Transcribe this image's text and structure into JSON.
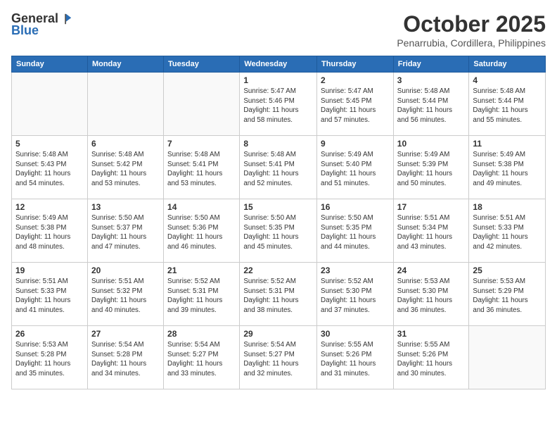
{
  "header": {
    "logo_general": "General",
    "logo_blue": "Blue",
    "month": "October 2025",
    "location": "Penarrubia, Cordillera, Philippines"
  },
  "weekdays": [
    "Sunday",
    "Monday",
    "Tuesday",
    "Wednesday",
    "Thursday",
    "Friday",
    "Saturday"
  ],
  "weeks": [
    [
      {
        "day": "",
        "info": ""
      },
      {
        "day": "",
        "info": ""
      },
      {
        "day": "",
        "info": ""
      },
      {
        "day": "1",
        "info": "Sunrise: 5:47 AM\nSunset: 5:46 PM\nDaylight: 11 hours\nand 58 minutes."
      },
      {
        "day": "2",
        "info": "Sunrise: 5:47 AM\nSunset: 5:45 PM\nDaylight: 11 hours\nand 57 minutes."
      },
      {
        "day": "3",
        "info": "Sunrise: 5:48 AM\nSunset: 5:44 PM\nDaylight: 11 hours\nand 56 minutes."
      },
      {
        "day": "4",
        "info": "Sunrise: 5:48 AM\nSunset: 5:44 PM\nDaylight: 11 hours\nand 55 minutes."
      }
    ],
    [
      {
        "day": "5",
        "info": "Sunrise: 5:48 AM\nSunset: 5:43 PM\nDaylight: 11 hours\nand 54 minutes."
      },
      {
        "day": "6",
        "info": "Sunrise: 5:48 AM\nSunset: 5:42 PM\nDaylight: 11 hours\nand 53 minutes."
      },
      {
        "day": "7",
        "info": "Sunrise: 5:48 AM\nSunset: 5:41 PM\nDaylight: 11 hours\nand 53 minutes."
      },
      {
        "day": "8",
        "info": "Sunrise: 5:48 AM\nSunset: 5:41 PM\nDaylight: 11 hours\nand 52 minutes."
      },
      {
        "day": "9",
        "info": "Sunrise: 5:49 AM\nSunset: 5:40 PM\nDaylight: 11 hours\nand 51 minutes."
      },
      {
        "day": "10",
        "info": "Sunrise: 5:49 AM\nSunset: 5:39 PM\nDaylight: 11 hours\nand 50 minutes."
      },
      {
        "day": "11",
        "info": "Sunrise: 5:49 AM\nSunset: 5:38 PM\nDaylight: 11 hours\nand 49 minutes."
      }
    ],
    [
      {
        "day": "12",
        "info": "Sunrise: 5:49 AM\nSunset: 5:38 PM\nDaylight: 11 hours\nand 48 minutes."
      },
      {
        "day": "13",
        "info": "Sunrise: 5:50 AM\nSunset: 5:37 PM\nDaylight: 11 hours\nand 47 minutes."
      },
      {
        "day": "14",
        "info": "Sunrise: 5:50 AM\nSunset: 5:36 PM\nDaylight: 11 hours\nand 46 minutes."
      },
      {
        "day": "15",
        "info": "Sunrise: 5:50 AM\nSunset: 5:35 PM\nDaylight: 11 hours\nand 45 minutes."
      },
      {
        "day": "16",
        "info": "Sunrise: 5:50 AM\nSunset: 5:35 PM\nDaylight: 11 hours\nand 44 minutes."
      },
      {
        "day": "17",
        "info": "Sunrise: 5:51 AM\nSunset: 5:34 PM\nDaylight: 11 hours\nand 43 minutes."
      },
      {
        "day": "18",
        "info": "Sunrise: 5:51 AM\nSunset: 5:33 PM\nDaylight: 11 hours\nand 42 minutes."
      }
    ],
    [
      {
        "day": "19",
        "info": "Sunrise: 5:51 AM\nSunset: 5:33 PM\nDaylight: 11 hours\nand 41 minutes."
      },
      {
        "day": "20",
        "info": "Sunrise: 5:51 AM\nSunset: 5:32 PM\nDaylight: 11 hours\nand 40 minutes."
      },
      {
        "day": "21",
        "info": "Sunrise: 5:52 AM\nSunset: 5:31 PM\nDaylight: 11 hours\nand 39 minutes."
      },
      {
        "day": "22",
        "info": "Sunrise: 5:52 AM\nSunset: 5:31 PM\nDaylight: 11 hours\nand 38 minutes."
      },
      {
        "day": "23",
        "info": "Sunrise: 5:52 AM\nSunset: 5:30 PM\nDaylight: 11 hours\nand 37 minutes."
      },
      {
        "day": "24",
        "info": "Sunrise: 5:53 AM\nSunset: 5:30 PM\nDaylight: 11 hours\nand 36 minutes."
      },
      {
        "day": "25",
        "info": "Sunrise: 5:53 AM\nSunset: 5:29 PM\nDaylight: 11 hours\nand 36 minutes."
      }
    ],
    [
      {
        "day": "26",
        "info": "Sunrise: 5:53 AM\nSunset: 5:28 PM\nDaylight: 11 hours\nand 35 minutes."
      },
      {
        "day": "27",
        "info": "Sunrise: 5:54 AM\nSunset: 5:28 PM\nDaylight: 11 hours\nand 34 minutes."
      },
      {
        "day": "28",
        "info": "Sunrise: 5:54 AM\nSunset: 5:27 PM\nDaylight: 11 hours\nand 33 minutes."
      },
      {
        "day": "29",
        "info": "Sunrise: 5:54 AM\nSunset: 5:27 PM\nDaylight: 11 hours\nand 32 minutes."
      },
      {
        "day": "30",
        "info": "Sunrise: 5:55 AM\nSunset: 5:26 PM\nDaylight: 11 hours\nand 31 minutes."
      },
      {
        "day": "31",
        "info": "Sunrise: 5:55 AM\nSunset: 5:26 PM\nDaylight: 11 hours\nand 30 minutes."
      },
      {
        "day": "",
        "info": ""
      }
    ]
  ]
}
